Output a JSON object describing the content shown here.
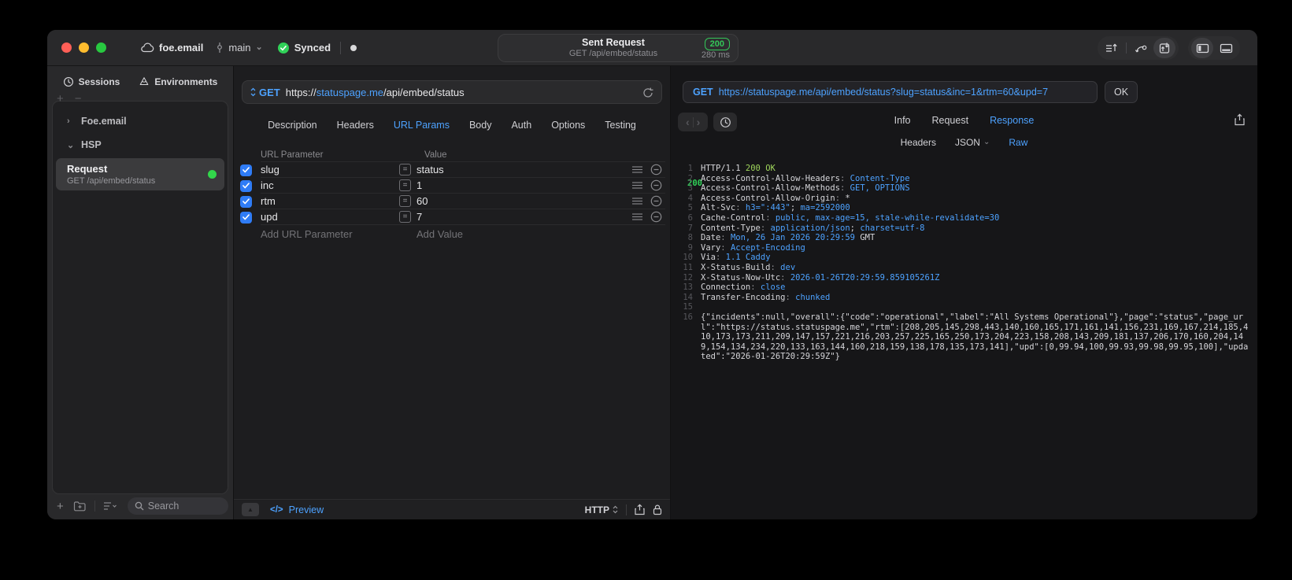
{
  "colors": {
    "accent_blue": "#4da2ff",
    "status_green": "#30d158",
    "code_green": "#9fd65c",
    "checkbox_blue": "#2f7cf6"
  },
  "glyphs": {
    "chevron_down": "⌄",
    "chevron_collapsed": "›",
    "nav_back": "‹",
    "nav_forward": "›",
    "up_triangle": "▲",
    "plus": "+",
    "minus": "−",
    "equals": "=",
    "preview_code": "</>"
  },
  "titlebar": {
    "workspace_name": "foe.email",
    "branch_name": "main",
    "sync_label": "Synced",
    "request_summary": {
      "title": "Sent Request",
      "subtitle": "GET /api/embed/status",
      "status_code": "200",
      "duration": "280 ms"
    }
  },
  "sidebar": {
    "tabs": [
      {
        "label": "Sessions",
        "icon": "clock-icon",
        "active": true
      },
      {
        "label": "Environments",
        "icon": "environments-icon",
        "active": false
      }
    ],
    "tree": [
      {
        "kind": "folder",
        "label": "Foe.email",
        "expanded": false
      },
      {
        "kind": "folder",
        "label": "HSP",
        "expanded": true
      },
      {
        "kind": "request",
        "title": "Request",
        "subtitle": "GET /api/embed/status",
        "selected": true,
        "has_status_dot": true
      }
    ],
    "search": {
      "placeholder": "Search"
    }
  },
  "request_editor": {
    "method": "GET",
    "url": {
      "scheme": "https://",
      "host": "statuspage.me",
      "path": "/api/embed/status"
    },
    "tabs": [
      "Description",
      "Headers",
      "URL Params",
      "Body",
      "Auth",
      "Options",
      "Testing"
    ],
    "active_tab": "URL Params",
    "params_table": {
      "columns": [
        "URL Parameter",
        "Value"
      ],
      "rows": [
        {
          "enabled": true,
          "name": "slug",
          "value": "status"
        },
        {
          "enabled": true,
          "name": "inc",
          "value": "1"
        },
        {
          "enabled": true,
          "name": "rtm",
          "value": "60"
        },
        {
          "enabled": true,
          "name": "upd",
          "value": "7"
        }
      ],
      "add_row": {
        "name_placeholder": "Add URL Parameter",
        "value_placeholder": "Add Value"
      }
    },
    "footer": {
      "preview_label": "Preview",
      "protocol": "HTTP"
    }
  },
  "response_viewer": {
    "request_line": {
      "method": "GET",
      "url": "https://statuspage.me/api/embed/status?slug=status&inc=1&rtm=60&upd=7"
    },
    "status": {
      "code": "200",
      "text": "OK"
    },
    "tabs": [
      "Info",
      "Request",
      "Response"
    ],
    "active_tab": "Response",
    "subtabs": [
      "Headers",
      "JSON",
      "Raw"
    ],
    "active_subtab": "Raw",
    "dropdown_subtab": "JSON",
    "body_lines": [
      {
        "n": 1,
        "segs": [
          [
            "HTTP/1.1 ",
            "w"
          ],
          [
            "200 OK",
            "g"
          ]
        ]
      },
      {
        "n": 2,
        "segs": [
          [
            "Access-Control-Allow-Headers",
            "w"
          ],
          [
            ": ",
            "d"
          ],
          [
            "Content-Type",
            "b"
          ]
        ]
      },
      {
        "n": 3,
        "segs": [
          [
            "Access-Control-Allow-Methods",
            "w"
          ],
          [
            ": ",
            "d"
          ],
          [
            "GET, OPTIONS",
            "b"
          ]
        ]
      },
      {
        "n": 4,
        "segs": [
          [
            "Access-Control-Allow-Origin",
            "w"
          ],
          [
            ": ",
            "d"
          ],
          [
            "*",
            "w"
          ]
        ]
      },
      {
        "n": 5,
        "segs": [
          [
            "Alt-Svc",
            "w"
          ],
          [
            ": ",
            "d"
          ],
          [
            "h3=\":443\"",
            "b"
          ],
          [
            "; ",
            "w"
          ],
          [
            "ma=2592000",
            "b"
          ]
        ]
      },
      {
        "n": 6,
        "segs": [
          [
            "Cache-Control",
            "w"
          ],
          [
            ": ",
            "d"
          ],
          [
            "public, max-age=15, stale-while-revalidate=30",
            "b"
          ]
        ]
      },
      {
        "n": 7,
        "segs": [
          [
            "Content-Type",
            "w"
          ],
          [
            ": ",
            "d"
          ],
          [
            "application/json",
            "b"
          ],
          [
            "; ",
            "w"
          ],
          [
            "charset=utf-8",
            "b"
          ]
        ]
      },
      {
        "n": 8,
        "segs": [
          [
            "Date",
            "w"
          ],
          [
            ": ",
            "d"
          ],
          [
            "Mon, 26 Jan 2026 20:29:59 ",
            "b"
          ],
          [
            "GMT",
            "w"
          ]
        ]
      },
      {
        "n": 9,
        "segs": [
          [
            "Vary",
            "w"
          ],
          [
            ": ",
            "d"
          ],
          [
            "Accept-Encoding",
            "b"
          ]
        ]
      },
      {
        "n": 10,
        "segs": [
          [
            "Via",
            "w"
          ],
          [
            ": ",
            "d"
          ],
          [
            "1.1 Caddy",
            "b"
          ]
        ]
      },
      {
        "n": 11,
        "segs": [
          [
            "X-Status-Build",
            "w"
          ],
          [
            ": ",
            "d"
          ],
          [
            "dev",
            "b"
          ]
        ]
      },
      {
        "n": 12,
        "segs": [
          [
            "X-Status-Now-Utc",
            "w"
          ],
          [
            ": ",
            "d"
          ],
          [
            "2026-01-26T20:29:59.859105261Z",
            "b"
          ]
        ]
      },
      {
        "n": 13,
        "segs": [
          [
            "Connection",
            "w"
          ],
          [
            ": ",
            "d"
          ],
          [
            "close",
            "b"
          ]
        ]
      },
      {
        "n": 14,
        "segs": [
          [
            "Transfer-Encoding",
            "w"
          ],
          [
            ": ",
            "d"
          ],
          [
            "chunked",
            "b"
          ]
        ]
      },
      {
        "n": 15,
        "segs": []
      },
      {
        "n": 16,
        "segs": [
          [
            "{\"incidents\":null,\"overall\":{\"code\":\"operational\",\"label\":\"All Systems Operational\"},\"page\":\"status\",\"page_url\":\"https://status.statuspage.me\",\"rtm\":[208,205,145,298,443,140,160,165,171,161,141,156,231,169,167,214,185,410,173,173,211,209,147,157,221,216,203,257,225,165,250,173,204,223,158,208,143,209,181,137,206,170,160,204,149,154,134,234,220,133,163,144,160,218,159,138,178,135,173,141],\"upd\":[0,99.94,100,99.93,99.98,99.95,100],\"updated\":\"2026-01-26T20:29:59Z\"}",
            "w"
          ]
        ]
      }
    ]
  }
}
